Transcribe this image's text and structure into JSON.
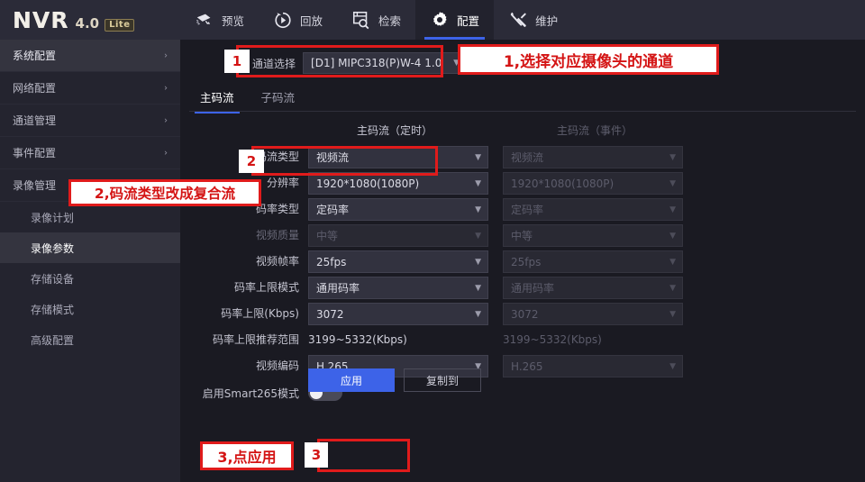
{
  "header": {
    "logo": "NVR",
    "version": "4.0",
    "edition": "Lite",
    "tabs": [
      {
        "label": "预览",
        "icon": "camera-icon",
        "active": false
      },
      {
        "label": "回放",
        "icon": "playback-icon",
        "active": false
      },
      {
        "label": "检索",
        "icon": "search-doc-icon",
        "active": false
      },
      {
        "label": "配置",
        "icon": "gear-icon",
        "active": true
      },
      {
        "label": "维护",
        "icon": "tools-icon",
        "active": false
      }
    ]
  },
  "sidebar": {
    "items": [
      {
        "label": "系统配置",
        "chevron": "›"
      },
      {
        "label": "网络配置",
        "chevron": "›"
      },
      {
        "label": "通道管理",
        "chevron": "›"
      },
      {
        "label": "事件配置",
        "chevron": "›"
      },
      {
        "label": "录像管理",
        "chevron": "⌄"
      }
    ],
    "sub_items": [
      {
        "label": "录像计划"
      },
      {
        "label": "录像参数"
      },
      {
        "label": "存储设备"
      },
      {
        "label": "存储模式"
      },
      {
        "label": "高级配置"
      }
    ]
  },
  "main": {
    "channel_label": "通道选择",
    "channel_value": "[D1] MIPC318(P)W-4 1.0",
    "stream_tabs": [
      {
        "label": "主码流"
      },
      {
        "label": "子码流"
      }
    ],
    "column_headers": {
      "timed": "主码流（定时）",
      "event": "主码流（事件）"
    },
    "rows": [
      {
        "label": "码流类型",
        "timed": "视频流",
        "event": "视频流",
        "type": "select"
      },
      {
        "label": "分辨率",
        "timed": "1920*1080(1080P)",
        "event": "1920*1080(1080P)",
        "type": "select"
      },
      {
        "label": "码率类型",
        "timed": "定码率",
        "event": "定码率",
        "type": "select"
      },
      {
        "label": "视频质量",
        "timed": "中等",
        "event": "中等",
        "type": "select_disabled"
      },
      {
        "label": "视频帧率",
        "timed": "25fps",
        "event": "25fps",
        "type": "select"
      },
      {
        "label": "码率上限模式",
        "timed": "通用码率",
        "event": "通用码率",
        "type": "select"
      },
      {
        "label": "码率上限(Kbps)",
        "timed": "3072",
        "event": "3072",
        "type": "select"
      },
      {
        "label": "码率上限推荐范围",
        "timed": "3199~5332(Kbps)",
        "event": "3199~5332(Kbps)",
        "type": "text"
      },
      {
        "label": "视频编码",
        "timed": "H.265",
        "event": "H.265",
        "type": "select"
      }
    ],
    "smart265": {
      "label": "启用Smart265模式",
      "state": "off"
    },
    "buttons": {
      "apply": "应用",
      "copy_to": "复制到"
    }
  },
  "annotations": {
    "step1_text": "1,选择对应摄像头的通道",
    "step2_text": "2,码流类型改成复合流",
    "step3_text": "3,点应用",
    "marker1": "1",
    "marker2": "2",
    "marker3": "3"
  },
  "colors": {
    "accent": "#3d63e8",
    "annotation_red": "#e01b1b",
    "header_bg": "#2b2b38",
    "sidebar_bg": "#24242f",
    "content_bg": "#1a1a22"
  }
}
